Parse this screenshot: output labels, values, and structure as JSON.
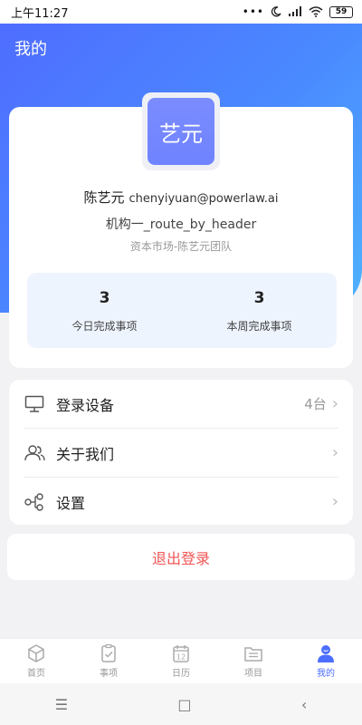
{
  "status": {
    "time": "上午11:27",
    "battery": "59"
  },
  "page_title": "我的",
  "profile": {
    "avatar_text": "艺元",
    "name": "陈艺元",
    "email": "chenyiyuan@powerlaw.ai",
    "org": "机构一_route_by_header",
    "team": "资本市场-陈艺元团队",
    "stats": [
      {
        "value": "3",
        "label": "今日完成事项"
      },
      {
        "value": "3",
        "label": "本周完成事项"
      }
    ]
  },
  "menu": {
    "devices": {
      "label": "登录设备",
      "value": "4台",
      "icon": "monitor-icon"
    },
    "about": {
      "label": "关于我们",
      "icon": "users-icon"
    },
    "settings": {
      "label": "设置",
      "icon": "share-nodes-icon"
    }
  },
  "logout_label": "退出登录",
  "tabs": [
    {
      "label": "首页",
      "icon": "cube-icon"
    },
    {
      "label": "事项",
      "icon": "clipboard-check-icon"
    },
    {
      "label": "日历",
      "icon": "calendar-icon",
      "day": "12"
    },
    {
      "label": "项目",
      "icon": "folder-list-icon"
    },
    {
      "label": "我的",
      "icon": "person-icon",
      "active": true
    }
  ],
  "colors": {
    "primary": "#4b6eff",
    "danger": "#f05454",
    "avatar": "#7384ff"
  }
}
